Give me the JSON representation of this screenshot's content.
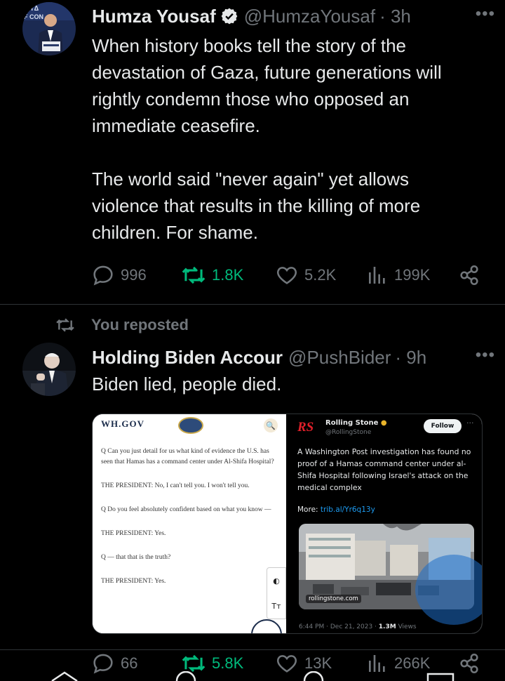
{
  "tweets": [
    {
      "author_name": "Humza Yousaf",
      "handle": "@HumzaYousaf",
      "time": "· 3h",
      "verified": true,
      "text": "When history books tell the story of the\ndevastation of Gaza, future generations will\nrightly condemn those who opposed an\nimmediate ceasefire.\n\nThe world said \"never again\" yet allows\nviolence that results in the killing of more\nchildren. For shame.",
      "replies": "996",
      "reposts": "1.8K",
      "likes": "5.2K",
      "views": "199K"
    },
    {
      "reposted_by": "You reposted",
      "author_name": "Holding Biden Accour",
      "handle": "@PushBider",
      "time": "· 9h",
      "text": "Biden lied, people died.",
      "replies": "66",
      "reposts": "5.8K",
      "likes": "13K",
      "views": "266K",
      "media": {
        "left_panel": {
          "site": "WH.GOV",
          "search_glyph": "🔍",
          "paragraphs": [
            "Q   Can you just detail for us what kind of evidence the U.S. has seen that Hamas has a command center under Al-Shifa Hospital?",
            "THE PRESIDENT:  No, I can't tell you.  I won't tell you.",
            "Q   Do you feel absolutely confident based on what you know —",
            "THE PRESIDENT:  Yes.",
            "Q   — that that is the truth?",
            "THE PRESIDENT:  Yes."
          ],
          "tool_contrast": "◐",
          "tool_text": "Tт"
        },
        "right_panel": {
          "logo": "RS",
          "name": "Rolling Stone",
          "handle": "@RollingStone",
          "follow": "Follow",
          "text": "A Washington Post investigation has found no proof of a Hamas command center under al-Shifa Hospital following Israel's attack on the medical complex",
          "more_label": "More: ",
          "more_link": "trib.al/Yr6q13y",
          "photo_url": "rollingstone.com",
          "timestamp": "6:44 PM · Dec 21, 2023 · ",
          "views": "1.3M",
          "views_label": " Views"
        }
      }
    }
  ],
  "colors": {
    "background": "#000000",
    "text": "#e7e9ea",
    "muted": "#71767b",
    "repost_active": "#00ba7c",
    "verified": "#e7e9ea"
  }
}
